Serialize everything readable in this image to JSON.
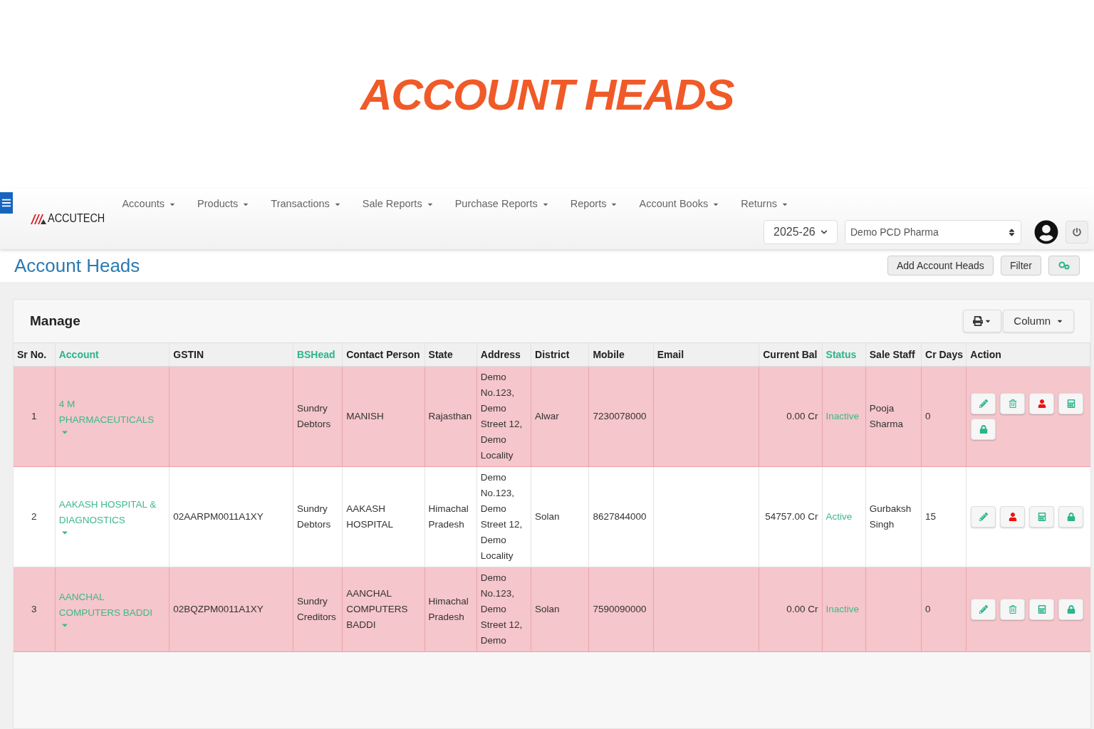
{
  "banner": {
    "title": "ACCOUNT HEADS"
  },
  "navbar": {
    "logo": "ACCUTECH",
    "menu": [
      "Accounts",
      "Products",
      "Transactions",
      "Sale Reports",
      "Purchase Reports",
      "Reports",
      "Account Books",
      "Returns"
    ],
    "year": "2025-26",
    "company": "Demo PCD Pharma"
  },
  "page": {
    "heading": "Account Heads",
    "buttons": [
      "Add Account Heads",
      "Filter"
    ]
  },
  "card": {
    "title": "Manage",
    "column_button": "Column"
  },
  "table": {
    "columns": [
      {
        "label": "Sr No.",
        "sortable": false
      },
      {
        "label": "Account",
        "sortable": true
      },
      {
        "label": "GSTIN",
        "sortable": false
      },
      {
        "label": "BSHead",
        "sortable": true
      },
      {
        "label": "Contact Person",
        "sortable": false
      },
      {
        "label": "State",
        "sortable": false
      },
      {
        "label": "Address",
        "sortable": false
      },
      {
        "label": "District",
        "sortable": false
      },
      {
        "label": "Mobile",
        "sortable": false
      },
      {
        "label": "Email",
        "sortable": false
      },
      {
        "label": "Current Bal",
        "sortable": false
      },
      {
        "label": "Status",
        "sortable": true
      },
      {
        "label": "Sale Staff",
        "sortable": false
      },
      {
        "label": "Cr Days",
        "sortable": false
      },
      {
        "label": "Action",
        "sortable": false
      }
    ],
    "rows": [
      {
        "highlighted": true,
        "sr": "1",
        "account": "4 M PHARMACEUTICALS",
        "gstin": "",
        "bshead": "Sundry Debtors",
        "contact": "MANISH",
        "state": "Rajasthan",
        "address": "Demo No.123, Demo Street 12, Demo Locality",
        "district": "Alwar",
        "mobile": "7230078000",
        "email": "",
        "balance": "0.00 Cr",
        "status": "Inactive",
        "staff": "Pooja Sharma",
        "cr_days": "0",
        "actions": [
          {
            "kind": "edit"
          },
          {
            "kind": "delete"
          },
          {
            "kind": "user"
          },
          {
            "kind": "calculator"
          },
          {
            "kind": "lock"
          }
        ]
      },
      {
        "highlighted": false,
        "sr": "2",
        "account": "AAKASH HOSPITAL & DIAGNOSTICS",
        "gstin": "02AARPM0011A1XY",
        "bshead": "Sundry Debtors",
        "contact": "AAKASH HOSPITAL",
        "state": "Himachal Pradesh",
        "address": "Demo No.123, Demo Street 12, Demo Locality",
        "district": "Solan",
        "mobile": "8627844000",
        "email": "",
        "balance": "54757.00 Cr",
        "status": "Active",
        "staff": "Gurbaksh Singh",
        "cr_days": "15",
        "actions": [
          {
            "kind": "edit"
          },
          {
            "kind": "user"
          },
          {
            "kind": "calculator"
          },
          {
            "kind": "lock"
          }
        ]
      },
      {
        "highlighted": true,
        "sr": "3",
        "account": "AANCHAL COMPUTERS BADDI",
        "gstin": "02BQZPM0011A1XY",
        "bshead": "Sundry Creditors",
        "contact": "AANCHAL COMPUTERS BADDI",
        "state": "Himachal Pradesh",
        "address": "Demo No.123, Demo Street 12, Demo",
        "district": "Solan",
        "mobile": "7590090000",
        "email": "",
        "balance": "0.00 Cr",
        "status": "Inactive",
        "staff": "",
        "cr_days": "0",
        "actions": [
          {
            "kind": "edit"
          },
          {
            "kind": "delete"
          },
          {
            "kind": "calculator"
          },
          {
            "kind": "lock"
          }
        ]
      }
    ]
  }
}
